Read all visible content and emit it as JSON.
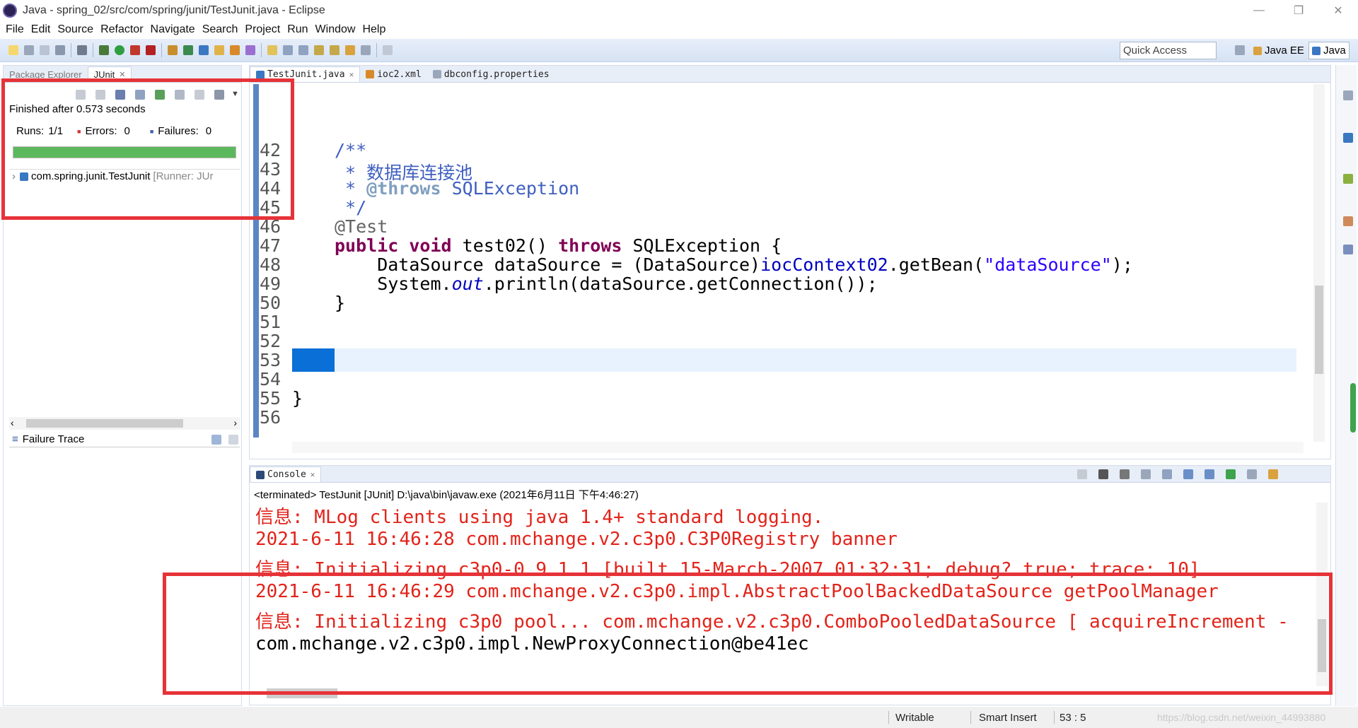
{
  "window": {
    "title": "Java - spring_02/src/com/spring/junit/TestJunit.java - Eclipse",
    "controls": [
      "—",
      "❐",
      "✕"
    ]
  },
  "menu": [
    "File",
    "Edit",
    "Source",
    "Refactor",
    "Navigate",
    "Search",
    "Project",
    "Run",
    "Window",
    "Help"
  ],
  "toolbar": {
    "quick_access": "Quick Access",
    "perspectives": [
      "Java EE",
      "Java"
    ]
  },
  "left_panel": {
    "tabs": [
      "Package Explorer",
      "JUnit"
    ],
    "finished": "Finished after 0.573 seconds",
    "runs_label": "Runs:",
    "runs_value": "1/1",
    "errors_label": "Errors:",
    "errors_value": "0",
    "failures_label": "Failures:",
    "failures_value": "0",
    "progress": 1.0,
    "test_item": "com.spring.junit.TestJunit",
    "test_runner": "[Runner: JUr",
    "failure_trace": "Failure Trace"
  },
  "editor": {
    "tabs": [
      "TestJunit.java",
      "ioc2.xml",
      "dbconfig.properties"
    ],
    "line_numbers": [
      "42",
      "43",
      "44",
      "45",
      "46",
      "47",
      "48",
      "49",
      "50",
      "51",
      "52",
      "53",
      "54",
      "55",
      "56"
    ],
    "lines": {
      "l42": "/**",
      "l43_star": " * ",
      "l43_text": "数据库连接池",
      "l44_star": " * ",
      "l44_tag": "@throws",
      "l44_text": " SQLException",
      "l45": " */",
      "l46": "@Test",
      "l47_kw1": "public",
      "l47_kw2": "void",
      "l47_mid": " test02() ",
      "l47_kw3": "throws",
      "l47_end": " SQLException {",
      "l48_a": "    DataSource dataSource = (DataSource)",
      "l48_fld": "iocContext02",
      "l48_b": ".getBean(",
      "l48_str": "\"dataSource\"",
      "l48_c": ");",
      "l49_a": "    System.",
      "l49_out": "out",
      "l49_b": ".println(dataSource.getConnection());",
      "l50": "}",
      "l55": "}"
    }
  },
  "console": {
    "tab": "Console",
    "header": "<terminated> TestJunit [JUnit] D:\\java\\bin\\javaw.exe (2021年6月11日 下午4:46:27)",
    "lines": [
      "信息: MLog clients using java 1.4+ standard logging.",
      "2021-6-11 16:46:28 com.mchange.v2.c3p0.C3P0Registry banner",
      "信息: Initializing c3p0-0.9.1.1 [built 15-March-2007 01:32:31; debug? true; trace: 10]",
      "2021-6-11 16:46:29 com.mchange.v2.c3p0.impl.AbstractPoolBackedDataSource getPoolManager",
      "信息: Initializing c3p0 pool... com.mchange.v2.c3p0.ComboPooledDataSource [ acquireIncrement -",
      "com.mchange.v2.c3p0.impl.NewProxyConnection@be41ec"
    ]
  },
  "status": {
    "writable": "Writable",
    "insert_mode": "Smart Insert",
    "position": "53 : 5",
    "watermark": "https://blog.csdn.net/weixin_44993880"
  },
  "colors": {
    "accent_red": "#e63338",
    "progress_green": "#5cb85c",
    "console_red": "#e2231a"
  }
}
